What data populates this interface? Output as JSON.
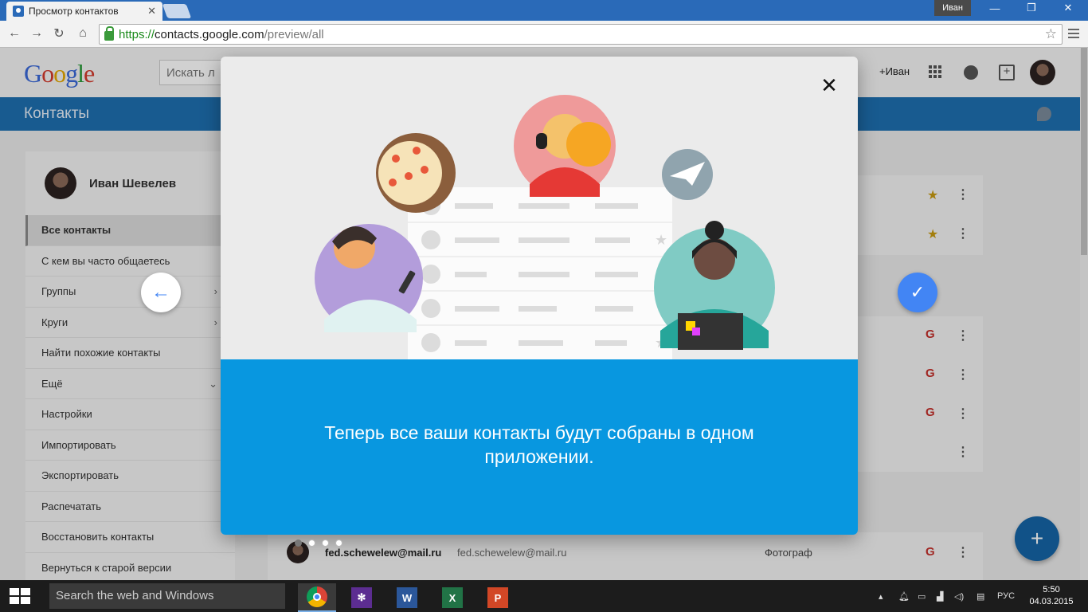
{
  "browser": {
    "tab_title": "Просмотр контактов",
    "tab_close": "✕",
    "user_label": "Иван",
    "url_scheme": "https://",
    "url_host": "contacts.google.com",
    "url_path": "/preview/all"
  },
  "header": {
    "logo": "Google",
    "search_placeholder": "Искать л",
    "account_link": "+Иван"
  },
  "app_bar": {
    "title": "Контакты"
  },
  "sidebar": {
    "user_name": "Иван Шевелев",
    "items": [
      {
        "label": "Все контакты",
        "active": true
      },
      {
        "label": "С кем вы часто общаетесь"
      },
      {
        "label": "Группы",
        "chevron": "›"
      },
      {
        "label": "Круги",
        "chevron": "›"
      },
      {
        "label": "Найти похожие контакты"
      },
      {
        "label": "Ещё",
        "chevron": "⌄"
      },
      {
        "label": "Настройки"
      },
      {
        "label": "Импортировать"
      },
      {
        "label": "Экспортировать"
      },
      {
        "label": "Распечатать"
      },
      {
        "label": "Восстановить контакты"
      },
      {
        "label": "Вернуться к старой версии"
      }
    ]
  },
  "contact_row": {
    "name": "fed.schewelew@mail.ru",
    "email": "fed.schewelew@mail.ru",
    "role": "Фотограф"
  },
  "modal": {
    "close_symbol": "✕",
    "message": "Теперь все ваши контакты будут собраны в одном приложении.",
    "total_pages": 4,
    "current_page": 1
  },
  "nav": {
    "prev_symbol": "←",
    "next_symbol": "✓"
  },
  "fab_symbol": "+",
  "taskbar": {
    "search_placeholder": "Search the web and Windows",
    "language": "РУС",
    "time": "5:50",
    "date": "04.03.2015"
  },
  "colors": {
    "blue_bar": "#1e6fb0",
    "modal_body": "#0897e0",
    "accent": "#4285f4",
    "star": "#c79a10",
    "google_circles": "#c4302b"
  },
  "icons": [
    "contacts-icon",
    "back-icon",
    "forward-icon",
    "reload-icon",
    "home-icon",
    "lock-icon",
    "bookmark-star-icon",
    "menu-icon",
    "apps-icon",
    "bell-icon",
    "share-icon",
    "hangouts-icon",
    "star-icon",
    "google-circles-icon",
    "more-icon",
    "close-icon",
    "arrow-left-icon",
    "check-icon",
    "plus-icon",
    "windows-icon",
    "chrome-icon",
    "settings-icon",
    "word-icon",
    "excel-icon",
    "powerpoint-icon"
  ]
}
